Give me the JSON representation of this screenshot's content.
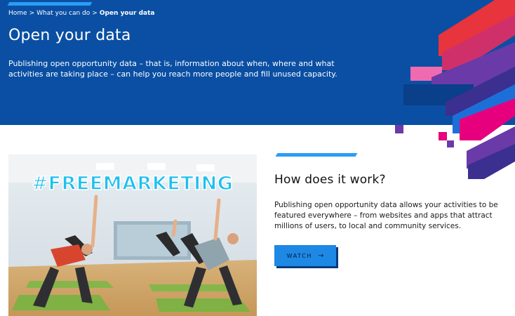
{
  "breadcrumb": {
    "home": "Home",
    "separator": ">",
    "section": "What you can do",
    "current": "Open your data"
  },
  "hero": {
    "title": "Open your data",
    "description": "Publishing open opportunity data – that is, information about when, where and what activities are taking place – can help you reach more people and fill unused capacity."
  },
  "media": {
    "overlay_text": "#FREEMARKETING"
  },
  "section": {
    "title": "How does it work?",
    "body": "Publishing open opportunity data allows your activities to be featured everywhere – from websites and apps that attract millions of users, to local and community services.",
    "button_label": "WATCH",
    "button_icon": "→"
  },
  "colors": {
    "hero_background": "#0a4fa3",
    "accent": "#2a9df4",
    "button": "#1e88e5",
    "deco_red": "#e8343c",
    "deco_pink": "#e6007e",
    "deco_purple": "#6a3aa8",
    "deco_violet": "#3b2f8f",
    "deco_blue": "#1d6fd8"
  }
}
